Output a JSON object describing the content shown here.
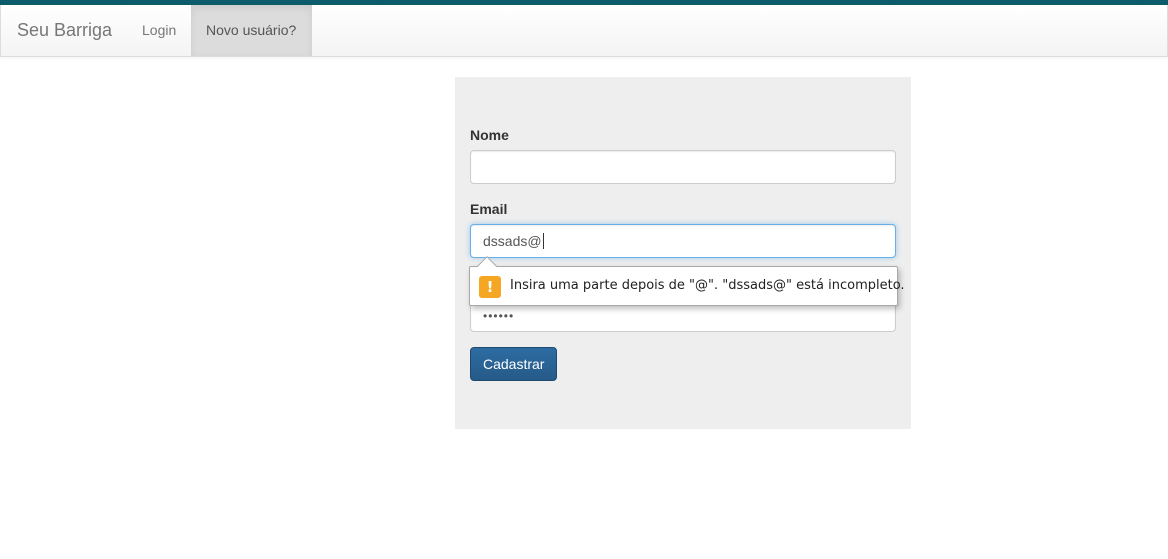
{
  "navbar": {
    "brand": "Seu Barriga",
    "items": [
      {
        "label": "Login"
      },
      {
        "label": "Novo usuário?"
      }
    ]
  },
  "form": {
    "nome": {
      "label": "Nome",
      "value": ""
    },
    "email": {
      "label": "Email",
      "value": "dssads@"
    },
    "senha": {
      "value": "••••••"
    },
    "submit_label": "Cadastrar"
  },
  "validation": {
    "icon": "warning-icon",
    "icon_glyph": "!",
    "message": "Insira uma parte depois de \"@\". \"dssads@\" está incompleto."
  },
  "colors": {
    "top_strip": "#0e5c6b",
    "button": "#265a88",
    "warning": "#f5a623"
  }
}
